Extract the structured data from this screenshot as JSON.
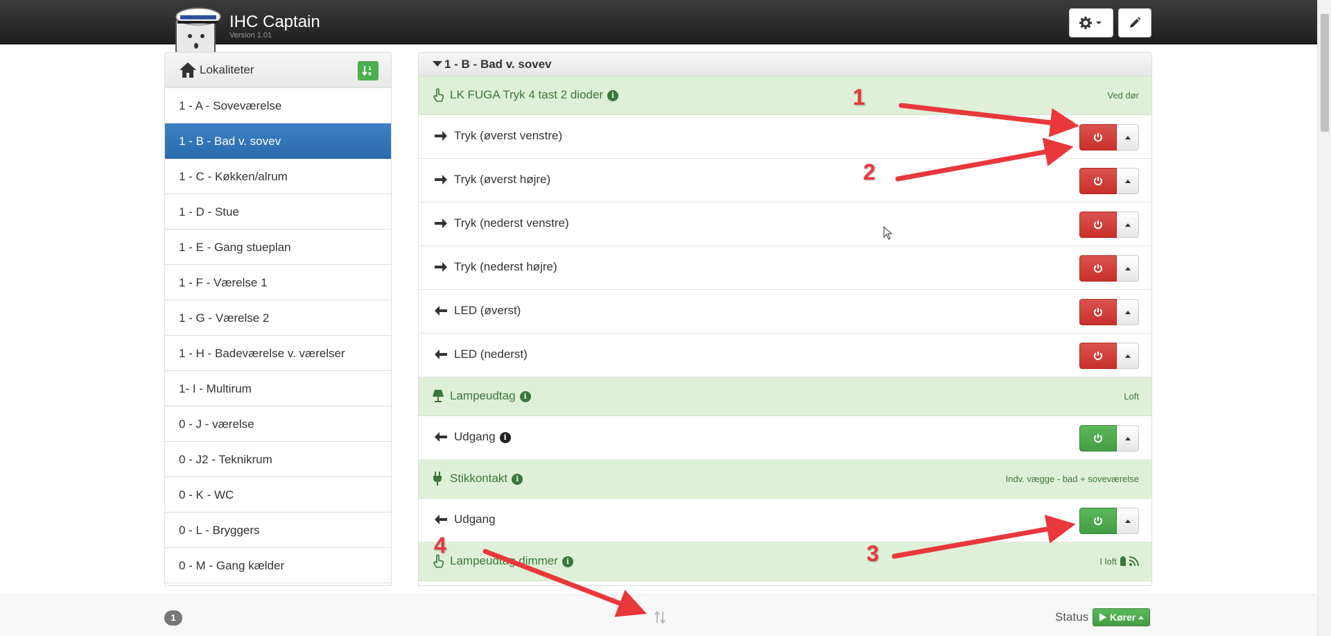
{
  "app": {
    "title": "IHC Captain",
    "version": "Version 1.01"
  },
  "sidebar": {
    "title": "Lokaliteter",
    "items": [
      {
        "label": "1 - A - Soveværelse",
        "active": false
      },
      {
        "label": "1 - B - Bad v. sovev",
        "active": true
      },
      {
        "label": "1 - C - Køkken/alrum",
        "active": false
      },
      {
        "label": "1 - D - Stue",
        "active": false
      },
      {
        "label": "1 - E - Gang stueplan",
        "active": false
      },
      {
        "label": "1 - F - Værelse 1",
        "active": false
      },
      {
        "label": "1 - G - Værelse 2",
        "active": false
      },
      {
        "label": "1 - H - Badeværelse v. værelser",
        "active": false
      },
      {
        "label": "1- I - Multirum",
        "active": false
      },
      {
        "label": "0 - J - værelse",
        "active": false
      },
      {
        "label": "0 - J2 - Teknikrum",
        "active": false
      },
      {
        "label": "0 - K - WC",
        "active": false
      },
      {
        "label": "0 - L - Bryggers",
        "active": false
      },
      {
        "label": "0 - M - Gang kælder",
        "active": false
      }
    ]
  },
  "main": {
    "title": "1 - B - Bad v. sovev",
    "groups": [
      {
        "name": "LK FUGA Tryk 4 tast 2 dioder",
        "location": "Ved dør",
        "rows": [
          {
            "label": "Tryk (øverst venstre)",
            "direction": "in",
            "state": "off"
          },
          {
            "label": "Tryk (øverst højre)",
            "direction": "in",
            "state": "off"
          },
          {
            "label": "Tryk (nederst venstre)",
            "direction": "in",
            "state": "off"
          },
          {
            "label": "Tryk (nederst højre)",
            "direction": "in",
            "state": "off"
          },
          {
            "label": "LED (øverst)",
            "direction": "out",
            "state": "off"
          },
          {
            "label": "LED (nederst)",
            "direction": "out",
            "state": "off"
          }
        ]
      },
      {
        "name": "Lampeudtag",
        "location": "Loft",
        "rows": [
          {
            "label": "Udgang",
            "direction": "out",
            "state": "on"
          }
        ]
      },
      {
        "name": "Stikkontakt",
        "location": "Indv. vægge - bad + soveværelse",
        "rows": [
          {
            "label": "Udgang",
            "direction": "out",
            "state": "on"
          }
        ]
      },
      {
        "name": "Lampeudtag dimmer",
        "location": "I loft",
        "rows": []
      }
    ]
  },
  "footer": {
    "badge": "1",
    "status_label": "Status",
    "status_value": "Kører"
  },
  "annotations": [
    "1",
    "2",
    "3",
    "4"
  ],
  "colors": {
    "off": "#d9534f",
    "on": "#5cb85c",
    "active": "#2a6aad",
    "group_bg": "#dff0d8",
    "arrow": "#e8383b"
  }
}
